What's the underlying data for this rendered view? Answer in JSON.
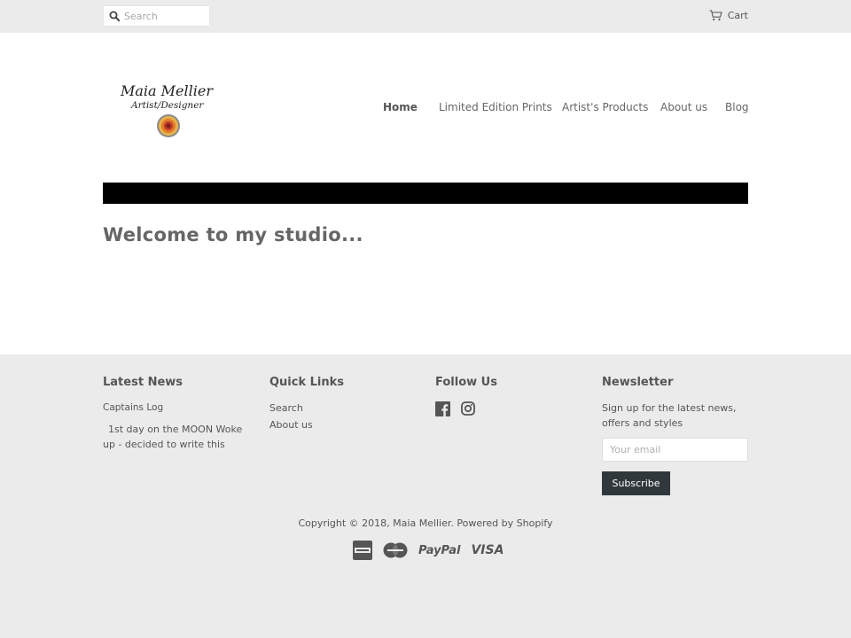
{
  "topbar": {
    "search_placeholder": "Search",
    "cart_label": "Cart"
  },
  "header": {
    "logo_alt": "Maia Mellier Artist/Designer",
    "nav": [
      {
        "label": "Home",
        "active": true
      },
      {
        "label": "Limited Edition Prints",
        "active": false
      },
      {
        "label": "Artist's Products",
        "active": false
      },
      {
        "label": "About us",
        "active": false
      },
      {
        "label": "Blog",
        "active": false
      }
    ]
  },
  "main": {
    "heading": "Welcome to my studio..."
  },
  "footer": {
    "latest_news": {
      "title": "Latest News",
      "post_title": "Captains Log",
      "post_excerpt": "1st day on the MOON Woke up - decided to write this"
    },
    "quick_links": {
      "title": "Quick Links",
      "links": [
        "Search",
        "About us"
      ]
    },
    "follow_us": {
      "title": "Follow Us",
      "icons": [
        "facebook-icon",
        "instagram-icon"
      ]
    },
    "newsletter": {
      "title": "Newsletter",
      "text": "Sign up for the latest news, offers and styles",
      "email_placeholder": "Your email",
      "button_label": "Subscribe"
    },
    "copyright": "Copyright © 2018, Maia Mellier. Powered by Shopify",
    "payments": [
      "american-express-icon",
      "master-card-icon",
      "PayPal",
      "VISA"
    ]
  },
  "colors": {
    "background": "#ebebeb",
    "bar": "#000000",
    "button": "#30383c"
  }
}
